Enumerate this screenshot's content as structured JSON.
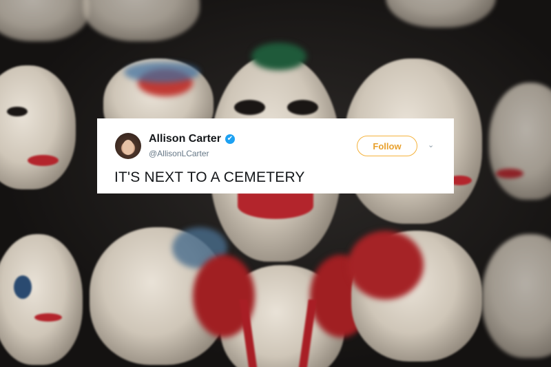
{
  "tweet": {
    "display_name": "Allison Carter",
    "handle": "@AllisonLCarter",
    "verified_icon": "✔",
    "follow_label": "Follow",
    "menu_icon": "⌄",
    "text": "IT'S NEXT TO A CEMETERY"
  },
  "icons": {
    "verified": "verified-badge-icon",
    "menu": "chevron-down-icon",
    "avatar": "avatar"
  },
  "colors": {
    "verified_blue": "#1da1f2",
    "follow_orange": "#f5b23b",
    "card_bg": "#ffffff",
    "mask_red": "#b3252c"
  }
}
